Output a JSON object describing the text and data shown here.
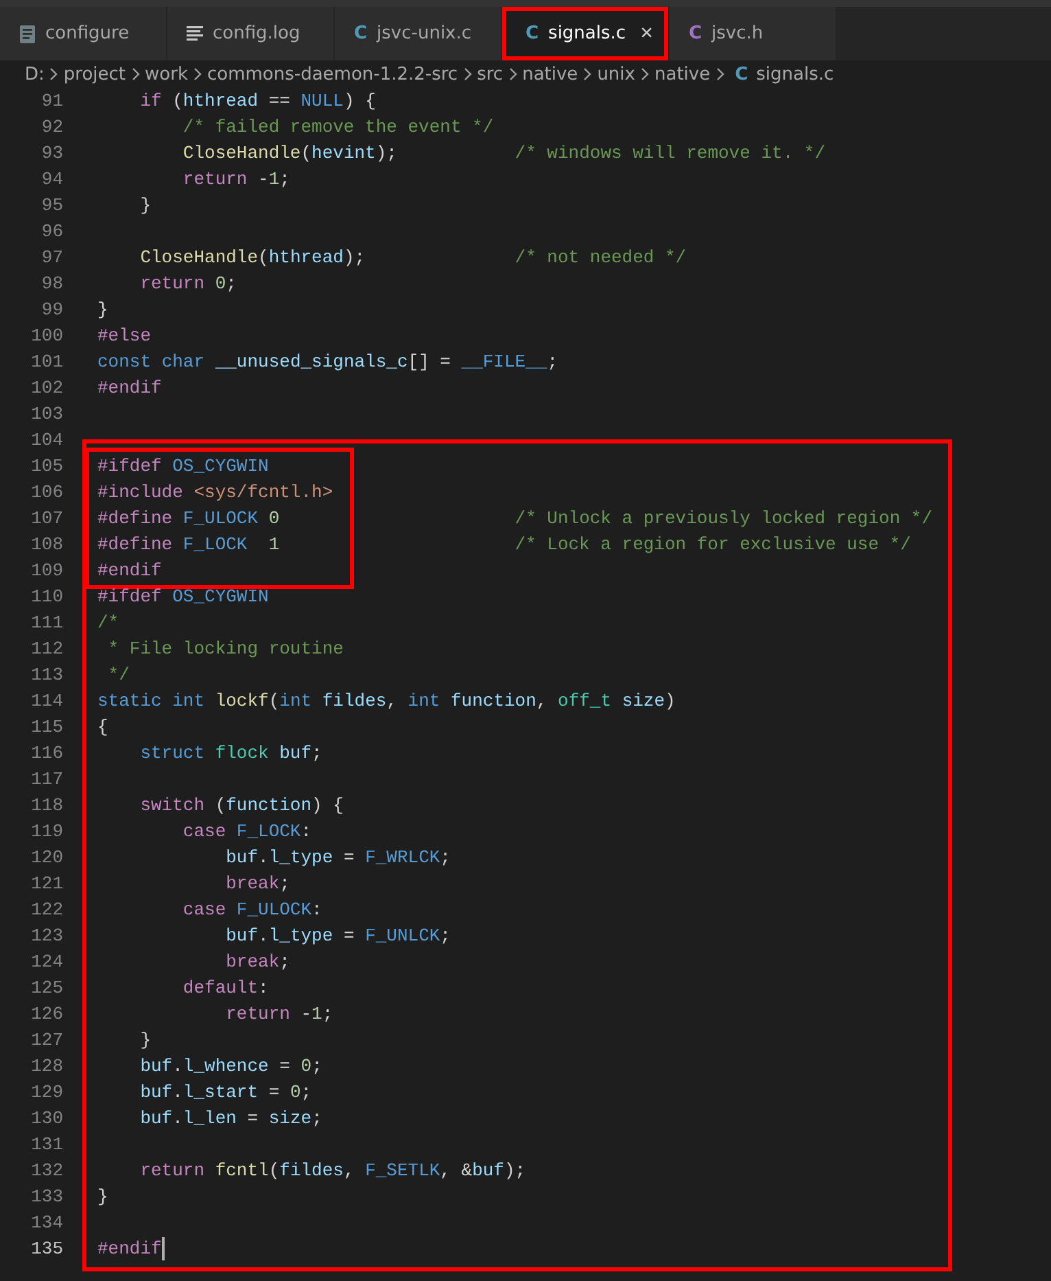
{
  "tabs": [
    {
      "label": "configure",
      "kind": "text_file",
      "selected": false,
      "outlined": false
    },
    {
      "label": "config.log",
      "kind": "log_file",
      "selected": false,
      "outlined": false
    },
    {
      "label": "jsvc-unix.c",
      "kind": "c_source",
      "badge": "C",
      "selected": false,
      "outlined": false
    },
    {
      "label": "signals.c",
      "kind": "c_source",
      "badge": "C",
      "selected": true,
      "outlined": true,
      "close": "×"
    },
    {
      "label": "jsvc.h",
      "kind": "c_header",
      "badge": "C",
      "selected": false,
      "outlined": false
    }
  ],
  "breadcrumb": {
    "parts": [
      "D:",
      "project",
      "work",
      "commons-daemon-1.2.2-src",
      "src",
      "native",
      "unix",
      "native"
    ],
    "file": "signals.c",
    "file_badge": "C"
  },
  "code": {
    "sections": [
      {
        "outlined": false,
        "blocks": [
          {
            "outlined": false,
            "lines": [
              {
                "n": "91",
                "t": [
                  {
                    "kind": "ctrl",
                    "text": "    if"
                  },
                  {
                    "kind": "p",
                    "text": " ("
                  },
                  {
                    "kind": "var",
                    "text": "hthread"
                  },
                  {
                    "kind": "p",
                    "text": " == "
                  },
                  {
                    "kind": "mac",
                    "text": "NULL"
                  },
                  {
                    "kind": "p",
                    "text": ") {"
                  }
                ]
              },
              {
                "n": "92",
                "t": [
                  {
                    "kind": "cmt",
                    "text": "        /* failed remove the event */"
                  }
                ]
              },
              {
                "n": "93",
                "t": [
                  {
                    "kind": "fn",
                    "text": "        CloseHandle"
                  },
                  {
                    "kind": "p",
                    "text": "("
                  },
                  {
                    "kind": "var",
                    "text": "hevint"
                  },
                  {
                    "kind": "p",
                    "text": ");"
                  },
                  {
                    "kind": "cmt",
                    "text": "           /* windows will remove it. */"
                  }
                ]
              },
              {
                "n": "94",
                "t": [
                  {
                    "kind": "ctrl",
                    "text": "        return"
                  },
                  {
                    "kind": "p",
                    "text": " -"
                  },
                  {
                    "kind": "num",
                    "text": "1"
                  },
                  {
                    "kind": "p",
                    "text": ";"
                  }
                ]
              },
              {
                "n": "95",
                "t": [
                  {
                    "kind": "p",
                    "text": "    }"
                  }
                ]
              },
              {
                "n": "96"
              },
              {
                "n": "97",
                "t": [
                  {
                    "kind": "fn",
                    "text": "    CloseHandle"
                  },
                  {
                    "kind": "p",
                    "text": "("
                  },
                  {
                    "kind": "var",
                    "text": "hthread"
                  },
                  {
                    "kind": "p",
                    "text": ");"
                  },
                  {
                    "kind": "cmt",
                    "text": "              /* not needed */"
                  }
                ]
              },
              {
                "n": "98",
                "t": [
                  {
                    "kind": "ctrl",
                    "text": "    return"
                  },
                  {
                    "kind": "num",
                    "text": " 0"
                  },
                  {
                    "kind": "p",
                    "text": ";"
                  }
                ]
              },
              {
                "n": "99",
                "t": [
                  {
                    "kind": "p",
                    "text": "}"
                  }
                ]
              },
              {
                "n": "100",
                "t": [
                  {
                    "kind": "ctrl",
                    "text": "#else"
                  }
                ]
              },
              {
                "n": "101",
                "t": [
                  {
                    "kind": "kw",
                    "text": "const"
                  },
                  {
                    "kind": "kw",
                    "text": " char"
                  },
                  {
                    "kind": "var",
                    "text": " __unused_signals_c"
                  },
                  {
                    "kind": "p",
                    "text": "[] = "
                  },
                  {
                    "kind": "mac",
                    "text": "__FILE__"
                  },
                  {
                    "kind": "p",
                    "text": ";"
                  }
                ]
              },
              {
                "n": "102",
                "t": [
                  {
                    "kind": "ctrl",
                    "text": "#endif"
                  }
                ]
              },
              {
                "n": "103"
              }
            ]
          }
        ]
      },
      {
        "outlined": true,
        "blocks": [
          {
            "outlined": false,
            "lines": [
              {
                "n": "104"
              }
            ]
          },
          {
            "outlined": true,
            "lines": [
              {
                "n": "105",
                "t": [
                  {
                    "kind": "ctrl",
                    "text": "#ifdef"
                  },
                  {
                    "kind": "mac",
                    "text": " OS_CYGWIN"
                  }
                ]
              },
              {
                "n": "106",
                "t": [
                  {
                    "kind": "ctrl",
                    "text": "#include"
                  },
                  {
                    "kind": "str",
                    "text": " <sys/fcntl.h>"
                  }
                ]
              },
              {
                "n": "107",
                "t": [
                  {
                    "kind": "ctrl",
                    "text": "#define"
                  },
                  {
                    "kind": "mac",
                    "text": " F_ULOCK"
                  },
                  {
                    "kind": "num",
                    "text": " 0"
                  },
                  {
                    "kind": "cmt",
                    "text": "                      /* Unlock a previously locked region */"
                  }
                ]
              },
              {
                "n": "108",
                "t": [
                  {
                    "kind": "ctrl",
                    "text": "#define"
                  },
                  {
                    "kind": "mac",
                    "text": " F_LOCK"
                  },
                  {
                    "kind": "num",
                    "text": "  1"
                  },
                  {
                    "kind": "cmt",
                    "text": "                      /* Lock a region for exclusive use */"
                  }
                ]
              },
              {
                "n": "109",
                "t": [
                  {
                    "kind": "ctrl",
                    "text": "#endif"
                  }
                ]
              }
            ]
          },
          {
            "outlined": false,
            "lines": [
              {
                "n": "110",
                "t": [
                  {
                    "kind": "ctrl",
                    "text": "#ifdef"
                  },
                  {
                    "kind": "mac",
                    "text": " OS_CYGWIN"
                  }
                ]
              },
              {
                "n": "111",
                "t": [
                  {
                    "kind": "cmt",
                    "text": "/*"
                  }
                ]
              },
              {
                "n": "112",
                "t": [
                  {
                    "kind": "cmt",
                    "text": " * File locking routine"
                  }
                ]
              },
              {
                "n": "113",
                "t": [
                  {
                    "kind": "cmt",
                    "text": " */"
                  }
                ]
              },
              {
                "n": "114",
                "t": [
                  {
                    "kind": "kw",
                    "text": "static"
                  },
                  {
                    "kind": "kw",
                    "text": " int"
                  },
                  {
                    "kind": "fn",
                    "text": " lockf"
                  },
                  {
                    "kind": "p",
                    "text": "("
                  },
                  {
                    "kind": "kw",
                    "text": "int"
                  },
                  {
                    "kind": "var",
                    "text": " fildes"
                  },
                  {
                    "kind": "p",
                    "text": ", "
                  },
                  {
                    "kind": "kw",
                    "text": "int"
                  },
                  {
                    "kind": "var",
                    "text": " function"
                  },
                  {
                    "kind": "p",
                    "text": ", "
                  },
                  {
                    "kind": "type",
                    "text": "off_t"
                  },
                  {
                    "kind": "var",
                    "text": " size"
                  },
                  {
                    "kind": "p",
                    "text": ")"
                  }
                ]
              },
              {
                "n": "115",
                "t": [
                  {
                    "kind": "p",
                    "text": "{"
                  }
                ]
              },
              {
                "n": "116",
                "t": [
                  {
                    "kind": "kw",
                    "text": "    struct"
                  },
                  {
                    "kind": "type",
                    "text": " flock"
                  },
                  {
                    "kind": "var",
                    "text": " buf"
                  },
                  {
                    "kind": "p",
                    "text": ";"
                  }
                ]
              },
              {
                "n": "117"
              },
              {
                "n": "118",
                "t": [
                  {
                    "kind": "ctrl",
                    "text": "    switch"
                  },
                  {
                    "kind": "p",
                    "text": " ("
                  },
                  {
                    "kind": "var",
                    "text": "function"
                  },
                  {
                    "kind": "p",
                    "text": ") {"
                  }
                ]
              },
              {
                "n": "119",
                "t": [
                  {
                    "kind": "ctrl",
                    "text": "        case"
                  },
                  {
                    "kind": "mac",
                    "text": " F_LOCK"
                  },
                  {
                    "kind": "p",
                    "text": ":"
                  }
                ]
              },
              {
                "n": "120",
                "t": [
                  {
                    "kind": "var",
                    "text": "            buf"
                  },
                  {
                    "kind": "p",
                    "text": "."
                  },
                  {
                    "kind": "var",
                    "text": "l_type"
                  },
                  {
                    "kind": "p",
                    "text": " = "
                  },
                  {
                    "kind": "mac",
                    "text": "F_WRLCK"
                  },
                  {
                    "kind": "p",
                    "text": ";"
                  }
                ]
              },
              {
                "n": "121",
                "t": [
                  {
                    "kind": "ctrl",
                    "text": "            break"
                  },
                  {
                    "kind": "p",
                    "text": ";"
                  }
                ]
              },
              {
                "n": "122",
                "t": [
                  {
                    "kind": "ctrl",
                    "text": "        case"
                  },
                  {
                    "kind": "mac",
                    "text": " F_ULOCK"
                  },
                  {
                    "kind": "p",
                    "text": ":"
                  }
                ]
              },
              {
                "n": "123",
                "t": [
                  {
                    "kind": "var",
                    "text": "            buf"
                  },
                  {
                    "kind": "p",
                    "text": "."
                  },
                  {
                    "kind": "var",
                    "text": "l_type"
                  },
                  {
                    "kind": "p",
                    "text": " = "
                  },
                  {
                    "kind": "mac",
                    "text": "F_UNLCK"
                  },
                  {
                    "kind": "p",
                    "text": ";"
                  }
                ]
              },
              {
                "n": "124",
                "t": [
                  {
                    "kind": "ctrl",
                    "text": "            break"
                  },
                  {
                    "kind": "p",
                    "text": ";"
                  }
                ]
              },
              {
                "n": "125",
                "t": [
                  {
                    "kind": "ctrl",
                    "text": "        default"
                  },
                  {
                    "kind": "p",
                    "text": ":"
                  }
                ]
              },
              {
                "n": "126",
                "t": [
                  {
                    "kind": "ctrl",
                    "text": "            return"
                  },
                  {
                    "kind": "p",
                    "text": " -"
                  },
                  {
                    "kind": "num",
                    "text": "1"
                  },
                  {
                    "kind": "p",
                    "text": ";"
                  }
                ]
              },
              {
                "n": "127",
                "t": [
                  {
                    "kind": "p",
                    "text": "    }"
                  }
                ]
              },
              {
                "n": "128",
                "t": [
                  {
                    "kind": "var",
                    "text": "    buf"
                  },
                  {
                    "kind": "p",
                    "text": "."
                  },
                  {
                    "kind": "var",
                    "text": "l_whence"
                  },
                  {
                    "kind": "p",
                    "text": " = "
                  },
                  {
                    "kind": "num",
                    "text": "0"
                  },
                  {
                    "kind": "p",
                    "text": ";"
                  }
                ]
              },
              {
                "n": "129",
                "t": [
                  {
                    "kind": "var",
                    "text": "    buf"
                  },
                  {
                    "kind": "p",
                    "text": "."
                  },
                  {
                    "kind": "var",
                    "text": "l_start"
                  },
                  {
                    "kind": "p",
                    "text": " = "
                  },
                  {
                    "kind": "num",
                    "text": "0"
                  },
                  {
                    "kind": "p",
                    "text": ";"
                  }
                ]
              },
              {
                "n": "130",
                "t": [
                  {
                    "kind": "var",
                    "text": "    buf"
                  },
                  {
                    "kind": "p",
                    "text": "."
                  },
                  {
                    "kind": "var",
                    "text": "l_len"
                  },
                  {
                    "kind": "p",
                    "text": " = "
                  },
                  {
                    "kind": "var",
                    "text": "size"
                  },
                  {
                    "kind": "p",
                    "text": ";"
                  }
                ]
              },
              {
                "n": "131"
              },
              {
                "n": "132",
                "t": [
                  {
                    "kind": "ctrl",
                    "text": "    return"
                  },
                  {
                    "kind": "fn",
                    "text": " fcntl"
                  },
                  {
                    "kind": "p",
                    "text": "("
                  },
                  {
                    "kind": "var",
                    "text": "fildes"
                  },
                  {
                    "kind": "p",
                    "text": ", "
                  },
                  {
                    "kind": "mac",
                    "text": "F_SETLK"
                  },
                  {
                    "kind": "p",
                    "text": ", &"
                  },
                  {
                    "kind": "var",
                    "text": "buf"
                  },
                  {
                    "kind": "p",
                    "text": ");"
                  }
                ]
              },
              {
                "n": "133",
                "t": [
                  {
                    "kind": "p",
                    "text": "}"
                  }
                ]
              },
              {
                "n": "134"
              },
              {
                "n": "135",
                "t": [
                  {
                    "kind": "ctrl",
                    "text": "#endif"
                  }
                ],
                "cursor": true
              }
            ]
          }
        ]
      }
    ]
  }
}
